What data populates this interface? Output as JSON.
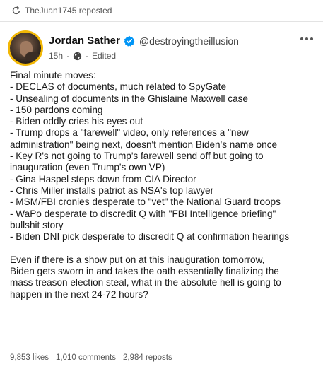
{
  "repost": {
    "label": "TheJuan1745 reposted"
  },
  "post": {
    "author": {
      "display_name": "Jordan Sather",
      "handle": "@destroyingtheillusion",
      "verified": true
    },
    "meta": {
      "time": "15h",
      "separator": "·",
      "visibility_icon": "globe-icon",
      "edited": "Edited"
    },
    "body_lines": [
      "Final minute moves:",
      "- DECLAS of documents, much related to SpyGate",
      "- Unsealing of documents in the Ghislaine Maxwell case",
      "- 150 pardons coming",
      "- Biden oddly cries his eyes out",
      "- Trump drops a \"farewell\" video, only references a \"new",
      "administration\" being next, doesn't mention Biden's name once",
      "- Key R's not going to Trump's farewell send off but going to",
      "inauguration (even Trump's own VP)",
      "- Gina Haspel steps down from CIA Director",
      "- Chris Miller installs patriot as NSA's top lawyer",
      "- MSM/FBI cronies desperate to \"vet\" the National Guard troops",
      "- WaPo desperate to discredit Q with \"FBI Intelligence briefing\"",
      "bullshit story",
      "- Biden DNI pick desperate to discredit Q at confirmation hearings",
      "",
      "Even if there is a show put on at this inauguration tomorrow,",
      "Biden gets sworn in and takes the oath essentially finalizing the",
      "mass treason election steal, what in the absolute hell is going to",
      "happen in the next 24-72 hours?"
    ],
    "stats": {
      "likes": "9,853 likes",
      "comments": "1,010 comments",
      "reposts": "2,984 reposts"
    }
  },
  "colors": {
    "verified_badge": "#0095f6",
    "avatar_ring": "#f2b705",
    "muted_text": "#555555"
  }
}
